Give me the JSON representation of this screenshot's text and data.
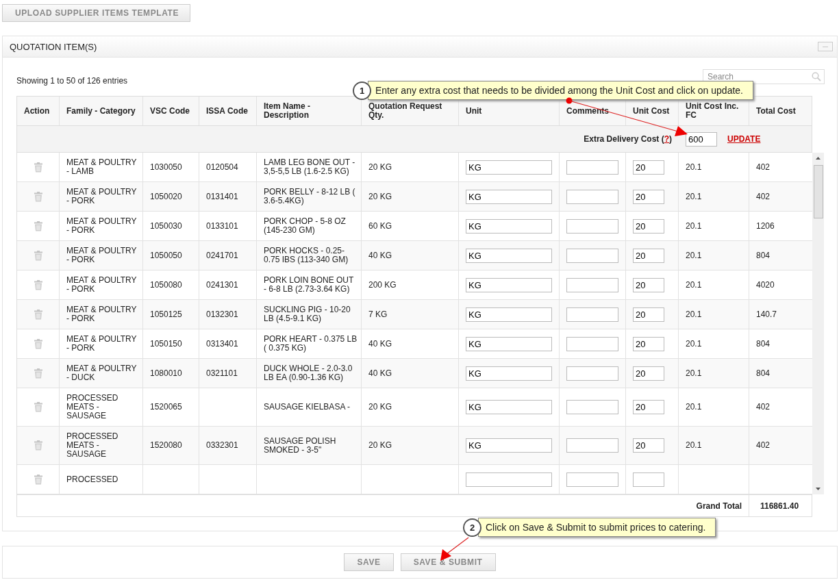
{
  "upload_button": "UPLOAD SUPPLIER ITEMS TEMPLATE",
  "panel": {
    "title": "QUOTATION ITEM(S)",
    "collapse_button": "—"
  },
  "info": "Showing 1 to 50 of 126 entries",
  "search": {
    "placeholder": "Search"
  },
  "columns": [
    "Action",
    "Family - Category",
    "VSC Code",
    "ISSA Code",
    "Item Name - Description",
    "Quotation Request Qty.",
    "Unit",
    "Comments",
    "Unit Cost",
    "Unit Cost Inc. FC",
    "Total Cost"
  ],
  "extra_cost": {
    "label_start": "Extra Delivery Cost (",
    "help_link": "?",
    "label_end": ")",
    "value": "600",
    "update_link": "UPDATE"
  },
  "rows": [
    {
      "family": "MEAT & POULTRY - LAMB",
      "vsc": "1030050",
      "issa": "0120504",
      "item": "LAMB LEG BONE OUT - 3,5-5,5 LB (1.6-2.5 KG)",
      "qty": "20 KG",
      "unit": "KG",
      "unit_cost": "20",
      "unit_cost_fc": "20.1",
      "total": "402"
    },
    {
      "family": "MEAT & POULTRY - PORK",
      "vsc": "1050020",
      "issa": "0131401",
      "item": "PORK BELLY - 8-12 LB ( 3.6-5.4KG)",
      "qty": "20 KG",
      "unit": "KG",
      "unit_cost": "20",
      "unit_cost_fc": "20.1",
      "total": "402"
    },
    {
      "family": "MEAT & POULTRY - PORK",
      "vsc": "1050030",
      "issa": "0133101",
      "item": "PORK CHOP - 5-8 OZ (145-230 GM)",
      "qty": "60 KG",
      "unit": "KG",
      "unit_cost": "20",
      "unit_cost_fc": "20.1",
      "total": "1206"
    },
    {
      "family": "MEAT & POULTRY - PORK",
      "vsc": "1050050",
      "issa": "0241701",
      "item": "PORK HOCKS - 0.25-0.75 IBS (113-340 GM)",
      "qty": "40 KG",
      "unit": "KG",
      "unit_cost": "20",
      "unit_cost_fc": "20.1",
      "total": "804"
    },
    {
      "family": "MEAT & POULTRY - PORK",
      "vsc": "1050080",
      "issa": "0241301",
      "item": "PORK LOIN BONE OUT - 6-8 LB (2.73-3.64 KG)",
      "qty": "200 KG",
      "unit": "KG",
      "unit_cost": "20",
      "unit_cost_fc": "20.1",
      "total": "4020"
    },
    {
      "family": "MEAT & POULTRY - PORK",
      "vsc": "1050125",
      "issa": "0132301",
      "item": "SUCKLING PIG - 10-20 LB (4.5-9.1 KG)",
      "qty": "7 KG",
      "unit": "KG",
      "unit_cost": "20",
      "unit_cost_fc": "20.1",
      "total": "140.7"
    },
    {
      "family": "MEAT & POULTRY - PORK",
      "vsc": "1050150",
      "issa": "0313401",
      "item": "PORK HEART - 0.375 LB ( 0.375 KG)",
      "qty": "40 KG",
      "unit": "KG",
      "unit_cost": "20",
      "unit_cost_fc": "20.1",
      "total": "804"
    },
    {
      "family": "MEAT & POULTRY - DUCK",
      "vsc": "1080010",
      "issa": "0321101",
      "item": "DUCK WHOLE - 2.0-3.0 LB EA (0.90-1.36 KG)",
      "qty": "40 KG",
      "unit": "KG",
      "unit_cost": "20",
      "unit_cost_fc": "20.1",
      "total": "804"
    },
    {
      "family": "PROCESSED MEATS - SAUSAGE",
      "vsc": "1520065",
      "item": "SAUSAGE KIELBASA -",
      "qty": "20 KG",
      "unit": "KG",
      "unit_cost": "20",
      "unit_cost_fc": "20.1",
      "total": "402"
    },
    {
      "family": "PROCESSED MEATS - SAUSAGE",
      "vsc": "1520080",
      "issa": "0332301",
      "item": "SAUSAGE POLISH SMOKED - 3-5\"",
      "qty": "20 KG",
      "unit": "KG",
      "unit_cost": "20",
      "unit_cost_fc": "20.1",
      "total": "402"
    },
    {
      "family": "PROCESSED"
    }
  ],
  "grand_total": {
    "label": "Grand Total",
    "value": "116861.40"
  },
  "callouts": [
    {
      "number": "1",
      "text": "Enter any extra cost that needs to be divided among the Unit Cost and click on update."
    },
    {
      "number": "2",
      "text": "Click on Save & Submit to submit prices to catering."
    }
  ],
  "buttons": [
    "SAVE",
    "SAVE & SUBMIT"
  ]
}
